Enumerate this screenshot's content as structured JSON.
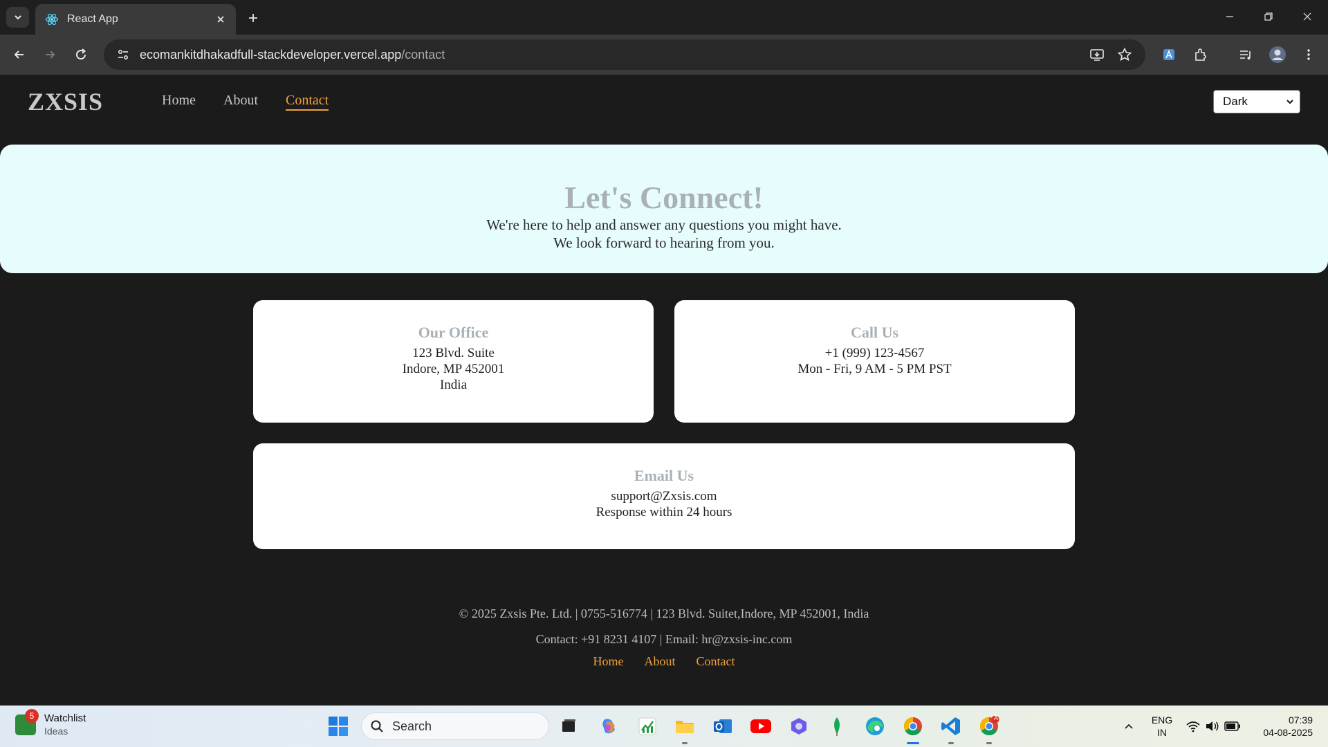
{
  "browser": {
    "tab_title": "React App",
    "url_host": "ecomankitdhakadfull-stackdeveloper.vercel.app",
    "url_path": "/contact"
  },
  "site": {
    "logo": "ZXSIS",
    "nav": [
      {
        "label": "Home"
      },
      {
        "label": "About"
      },
      {
        "label": "Contact",
        "active": true
      }
    ],
    "theme_select": {
      "value": "Dark"
    }
  },
  "hero": {
    "title": "Let's Connect!",
    "line1": "We're here to help and answer any questions you might have.",
    "line2": "We look forward to hearing from you."
  },
  "cards": {
    "office": {
      "title": "Our Office",
      "lines": [
        "123 Blvd. Suite",
        "Indore, MP 452001",
        "India"
      ]
    },
    "call": {
      "title": "Call Us",
      "lines": [
        "+1 (999) 123-4567",
        "Mon - Fri, 9 AM - 5 PM PST"
      ]
    },
    "email": {
      "title": "Email Us",
      "lines": [
        "support@Zxsis.com",
        "Response within 24 hours"
      ]
    }
  },
  "footer": {
    "line1": "© 2025 Zxsis Pte. Ltd. | 0755-516774 | 123 Blvd. Suitet,Indore, MP 452001, India",
    "line2": "Contact: +91 8231 4107 | Email: hr@zxsis-inc.com",
    "links": [
      {
        "label": "Home"
      },
      {
        "label": "About"
      },
      {
        "label": "Contact"
      }
    ]
  },
  "taskbar": {
    "widget_badge": "5",
    "widget_title": "Watchlist",
    "widget_sub": "Ideas",
    "search_placeholder": "Search",
    "lang": "ENG",
    "region": "IN",
    "time": "07:39",
    "date": "04-08-2025",
    "chrome_badge": "A"
  },
  "colors": {
    "accent": "#f0a23a",
    "hero_bg": "#e7fdfd",
    "page_bg": "#1b1b1b",
    "heading_gray": "#a9b1b7"
  }
}
